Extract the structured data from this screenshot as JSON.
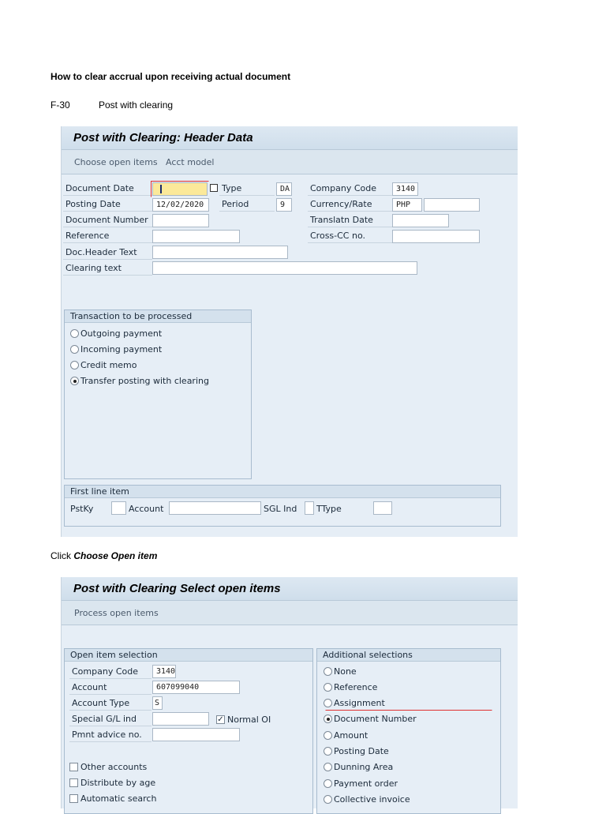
{
  "doc": {
    "heading": "How to clear accrual upon receiving actual document",
    "tcode": "F-30",
    "tcode_desc": "Post with clearing",
    "click_prefix": "Click ",
    "click_target": "Choose Open item"
  },
  "screen1": {
    "title": "Post with Clearing: Header Data",
    "toolbar": [
      "Choose open items",
      "Acct model"
    ],
    "fields": {
      "document_date": {
        "label": "Document Date",
        "value": ""
      },
      "type": {
        "label": "Type",
        "value": "DA"
      },
      "company_code": {
        "label": "Company Code",
        "value": "3140"
      },
      "posting_date": {
        "label": "Posting Date",
        "value": "12/02/2020"
      },
      "period": {
        "label": "Period",
        "value": "9"
      },
      "currency": {
        "label": "Currency/Rate",
        "value": "PHP",
        "rate": ""
      },
      "document_number": {
        "label": "Document Number",
        "value": ""
      },
      "translatn_date": {
        "label": "Translatn Date",
        "value": ""
      },
      "reference": {
        "label": "Reference",
        "value": ""
      },
      "cross_cc": {
        "label": "Cross-CC no.",
        "value": ""
      },
      "doc_header_text": {
        "label": "Doc.Header Text",
        "value": ""
      },
      "clearing_text": {
        "label": "Clearing text",
        "value": ""
      }
    },
    "transaction_group": {
      "title": "Transaction to be processed",
      "options": [
        {
          "label": "Outgoing payment",
          "selected": false
        },
        {
          "label": "Incoming payment",
          "selected": false
        },
        {
          "label": "Credit memo",
          "selected": false
        },
        {
          "label": "Transfer posting with clearing",
          "selected": true
        }
      ]
    },
    "first_line": {
      "title": "First line item",
      "pstky": "PstKy",
      "account": "Account",
      "sgl": "SGL Ind",
      "ttype": "TType"
    }
  },
  "screen2": {
    "title": "Post with Clearing Select open items",
    "toolbar": [
      "Process open items"
    ],
    "open_item": {
      "title": "Open item selection",
      "company_code": {
        "label": "Company Code",
        "value": "3140"
      },
      "account": {
        "label": "Account",
        "value": "607099040"
      },
      "account_type": {
        "label": "Account Type",
        "value": "S"
      },
      "special_gl": {
        "label": "Special G/L ind",
        "value": ""
      },
      "normal_oi": "Normal OI",
      "pmnt_advice": {
        "label": "Pmnt advice no.",
        "value": ""
      },
      "checks": [
        "Other accounts",
        "Distribute by age",
        "Automatic search"
      ]
    },
    "additional": {
      "title": "Additional selections",
      "options": [
        {
          "label": "None",
          "selected": false
        },
        {
          "label": "Reference",
          "selected": false
        },
        {
          "label": "Assignment",
          "selected": false
        },
        {
          "label": "Document Number",
          "selected": true
        },
        {
          "label": "Amount",
          "selected": false
        },
        {
          "label": "Posting Date",
          "selected": false
        },
        {
          "label": "Dunning Area",
          "selected": false
        },
        {
          "label": "Payment order",
          "selected": false
        },
        {
          "label": "Collective invoice",
          "selected": false
        }
      ]
    }
  }
}
